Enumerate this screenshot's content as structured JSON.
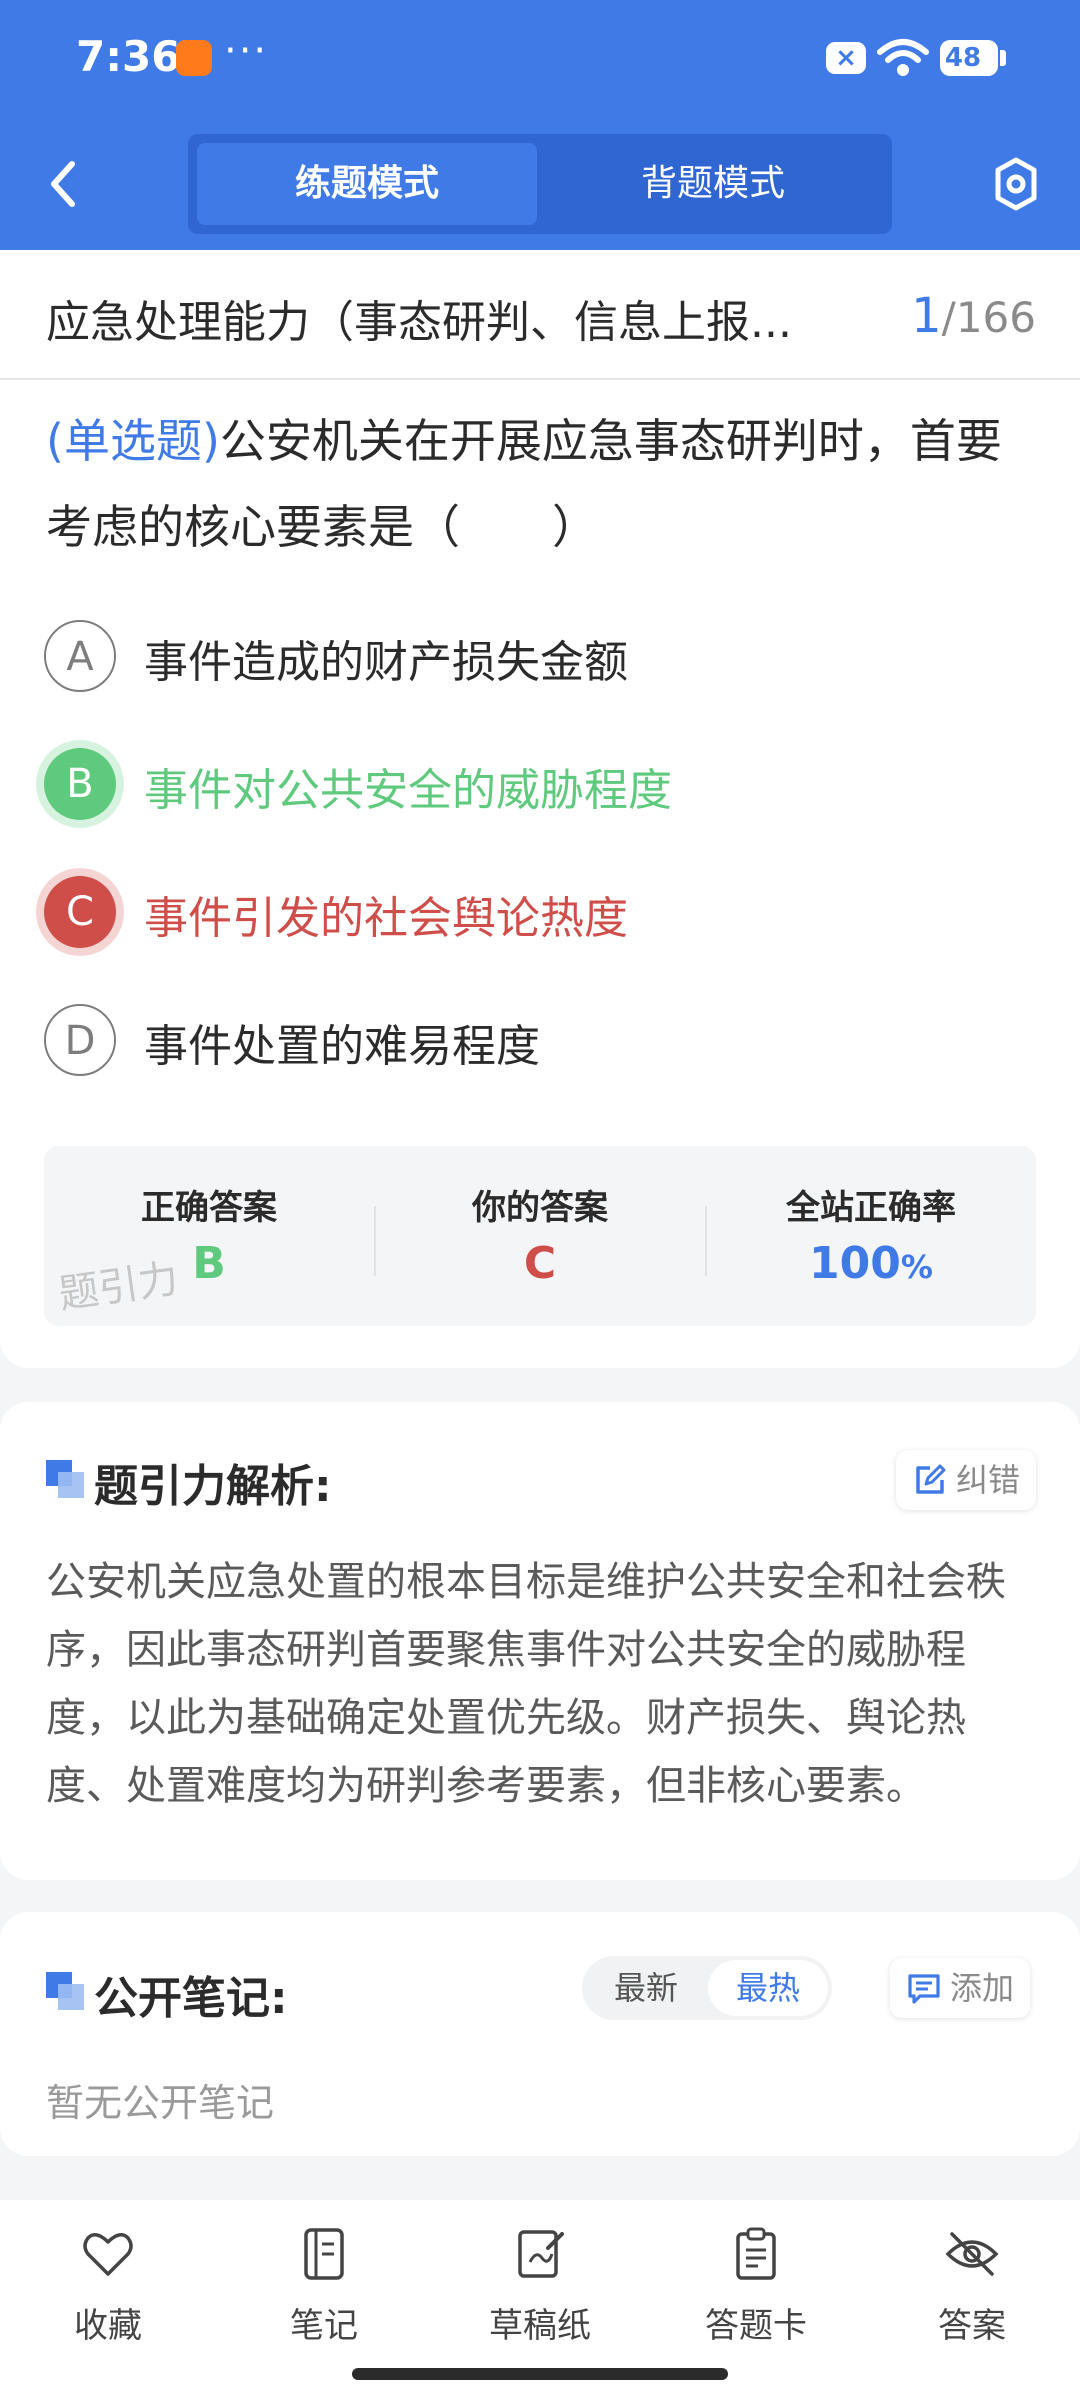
{
  "status_bar": {
    "time": "7:36",
    "dots": "···",
    "battery": "48"
  },
  "header": {
    "tabs": [
      {
        "label": "练题模式",
        "active": true
      },
      {
        "label": "背题模式",
        "active": false
      }
    ],
    "accent_color": "#3f7ae7"
  },
  "topic": {
    "title": "应急处理能力（事态研判、信息上报...",
    "current": "1",
    "total": "/166"
  },
  "question": {
    "type": "(单选题)",
    "text": "公安机关在开展应急事态研判时，首要考虑的核心要素是（　　）",
    "options": [
      {
        "letter": "A",
        "text": "事件造成的财产损失金额",
        "state": "normal"
      },
      {
        "letter": "B",
        "text": "事件对公共安全的威胁程度",
        "state": "correct"
      },
      {
        "letter": "C",
        "text": "事件引发的社会舆论热度",
        "state": "wrong"
      },
      {
        "letter": "D",
        "text": "事件处置的难易程度",
        "state": "normal"
      }
    ],
    "correct_color": "#5fc97d",
    "wrong_color": "#cf4e4a"
  },
  "answer_summary": {
    "correct_label": "正确答案",
    "correct_value": "B",
    "yours_label": "你的答案",
    "yours_value": "C",
    "rate_label": "全站正确率",
    "rate_value": "100",
    "rate_unit": "%",
    "watermark": "题引力"
  },
  "analysis": {
    "title": "题引力解析:",
    "report_label": "纠错",
    "text": "公安机关应急处置的根本目标是维护公共安全和社会秩序，因此事态研判首要聚焦事件对公共安全的威胁程度，以此为基础确定处置优先级。财产损失、舆论热度、处置难度均为研判参考要素，但非核心要素。"
  },
  "notes": {
    "title": "公开笔记:",
    "sort_options": [
      "最新",
      "最热"
    ],
    "sort_active": "最热",
    "add_label": "添加",
    "empty_text": "暂无公开笔记"
  },
  "toolbar": {
    "items": [
      {
        "label": "收藏",
        "icon": "heart-icon"
      },
      {
        "label": "笔记",
        "icon": "notebook-icon"
      },
      {
        "label": "草稿纸",
        "icon": "draft-paper-icon"
      },
      {
        "label": "答题卡",
        "icon": "answer-sheet-icon"
      },
      {
        "label": "答案",
        "icon": "eye-off-icon"
      }
    ]
  }
}
